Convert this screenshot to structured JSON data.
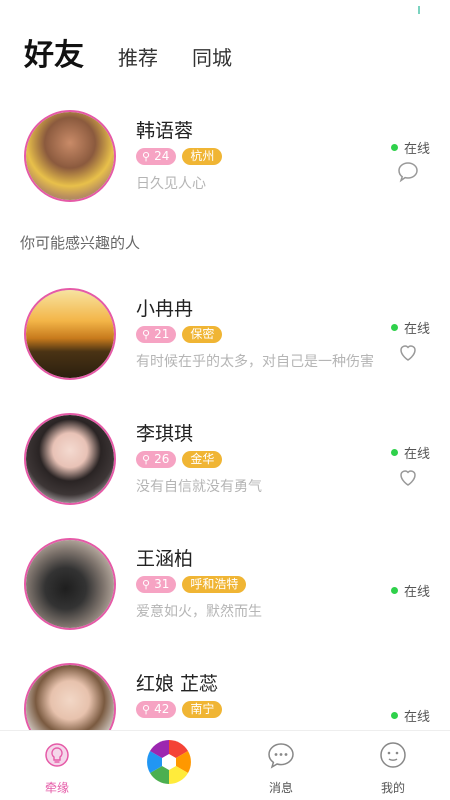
{
  "header_tabs": [
    {
      "label": "好友",
      "active": true
    },
    {
      "label": "推荐",
      "active": false
    },
    {
      "label": "同城",
      "active": false
    }
  ],
  "friend": {
    "name": "韩语蓉",
    "age": "24",
    "city": "杭州",
    "motto": "日久见人心",
    "status": "在线",
    "action_icon": "chat-bubble-icon"
  },
  "section_label": "你可能感兴趣的人",
  "suggestions": [
    {
      "name": "小冉冉",
      "age": "21",
      "city": "保密",
      "motto": "有时候在乎的太多，对自己是一种伤害",
      "status": "在线",
      "action_icon": "heart-outline-icon"
    },
    {
      "name": "李琪琪",
      "age": "26",
      "city": "金华",
      "motto": "没有自信就没有勇气",
      "status": "在线",
      "action_icon": "heart-outline-icon"
    },
    {
      "name": "王涵柏",
      "age": "31",
      "city": "呼和浩特",
      "motto": "爱意如火，默然而生",
      "status": "在线",
      "action_icon": ""
    },
    {
      "name": "红娘 芷蕊",
      "age": "42",
      "city": "南宁",
      "motto": "",
      "status": "在线",
      "action_icon": ""
    }
  ],
  "bottom_nav": [
    {
      "label": "牵缘",
      "icon": "bulb-icon",
      "active": true
    },
    {
      "label": "",
      "icon": "camera-aperture-icon",
      "active": false
    },
    {
      "label": "消息",
      "icon": "message-bubble-icon",
      "active": false
    },
    {
      "label": "我的",
      "icon": "smile-face-icon",
      "active": false
    }
  ],
  "colors": {
    "accent_pink": "#e55aa7",
    "age_badge": "#f6a3c3",
    "city_badge": "#f0b534",
    "online_dot": "#2fd14b"
  }
}
